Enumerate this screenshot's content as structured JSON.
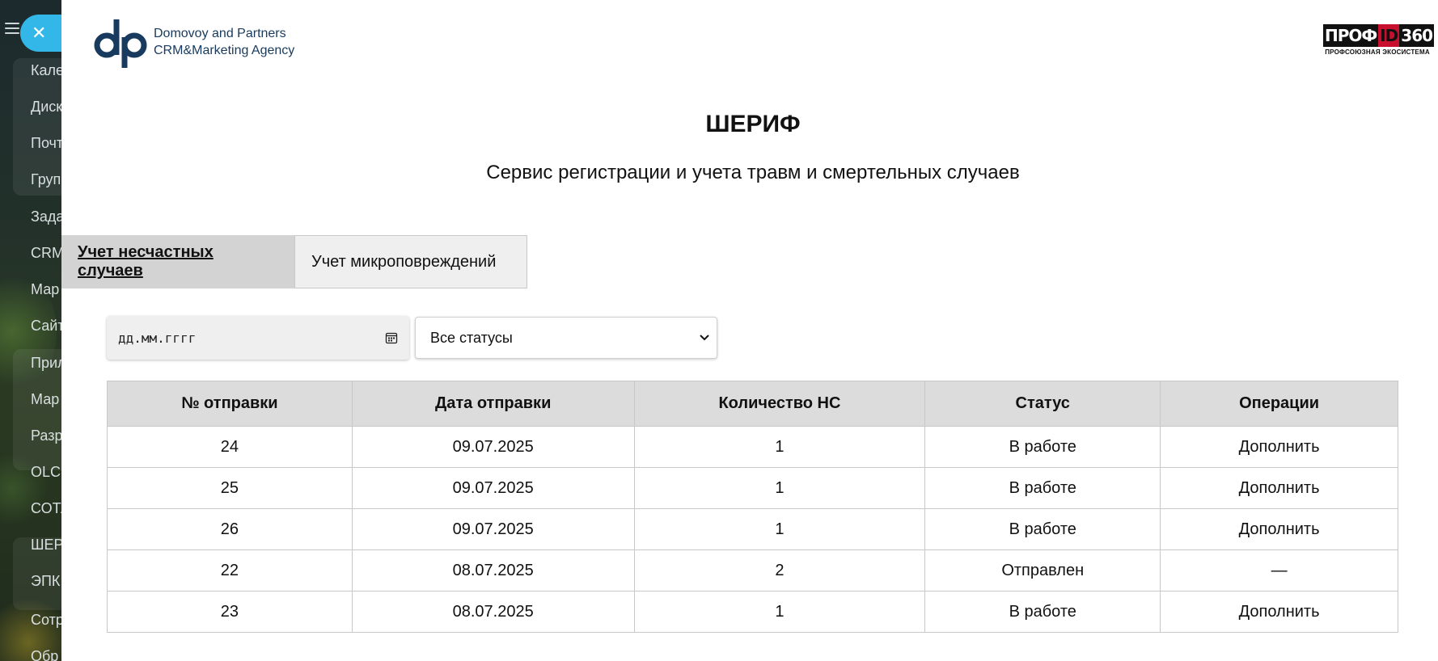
{
  "sidebar": {
    "items": [
      "Кале",
      "Диск",
      "Почт",
      "Груп",
      "Зада",
      "CRM",
      "Мар",
      "Сайт",
      "Прил",
      "Мар",
      "Разр",
      "OLCH",
      "СОТА",
      "ШЕР",
      "ЭПК",
      "Сотр",
      "Обр"
    ]
  },
  "brand": {
    "dp_line1": "Domovoy and Partners",
    "dp_line2": "CRM&Marketing Agency",
    "prof_part1": "ПРОФ",
    "prof_part2": "ID",
    "prof_part3": "360",
    "prof_sub": "ПРОФСОЮЗНАЯ ЭКОСИСТЕМА",
    "accent_color": "#c8102e",
    "dp_color": "#173a5e"
  },
  "header": {
    "title": "ШЕРИФ",
    "subtitle": "Сервис регистрации и учета травм и смертельных случаев"
  },
  "tabs": [
    {
      "label": "Учет несчастных случаев",
      "active": true
    },
    {
      "label": "Учет микроповреждений",
      "active": false
    }
  ],
  "filters": {
    "date_placeholder": "дд.мм.гггг",
    "status_selected": "Все статусы"
  },
  "table": {
    "headers": [
      "№ отправки",
      "Дата отправки",
      "Количество НС",
      "Статус",
      "Операции"
    ],
    "rows": [
      {
        "num": "24",
        "date": "09.07.2025",
        "count": "1",
        "status": "В работе",
        "op": "Дополнить"
      },
      {
        "num": "25",
        "date": "09.07.2025",
        "count": "1",
        "status": "В работе",
        "op": "Дополнить"
      },
      {
        "num": "26",
        "date": "09.07.2025",
        "count": "1",
        "status": "В работе",
        "op": "Дополнить"
      },
      {
        "num": "22",
        "date": "08.07.2025",
        "count": "2",
        "status": "Отправлен",
        "op": "—"
      },
      {
        "num": "23",
        "date": "08.07.2025",
        "count": "1",
        "status": "В работе",
        "op": "Дополнить"
      }
    ]
  }
}
